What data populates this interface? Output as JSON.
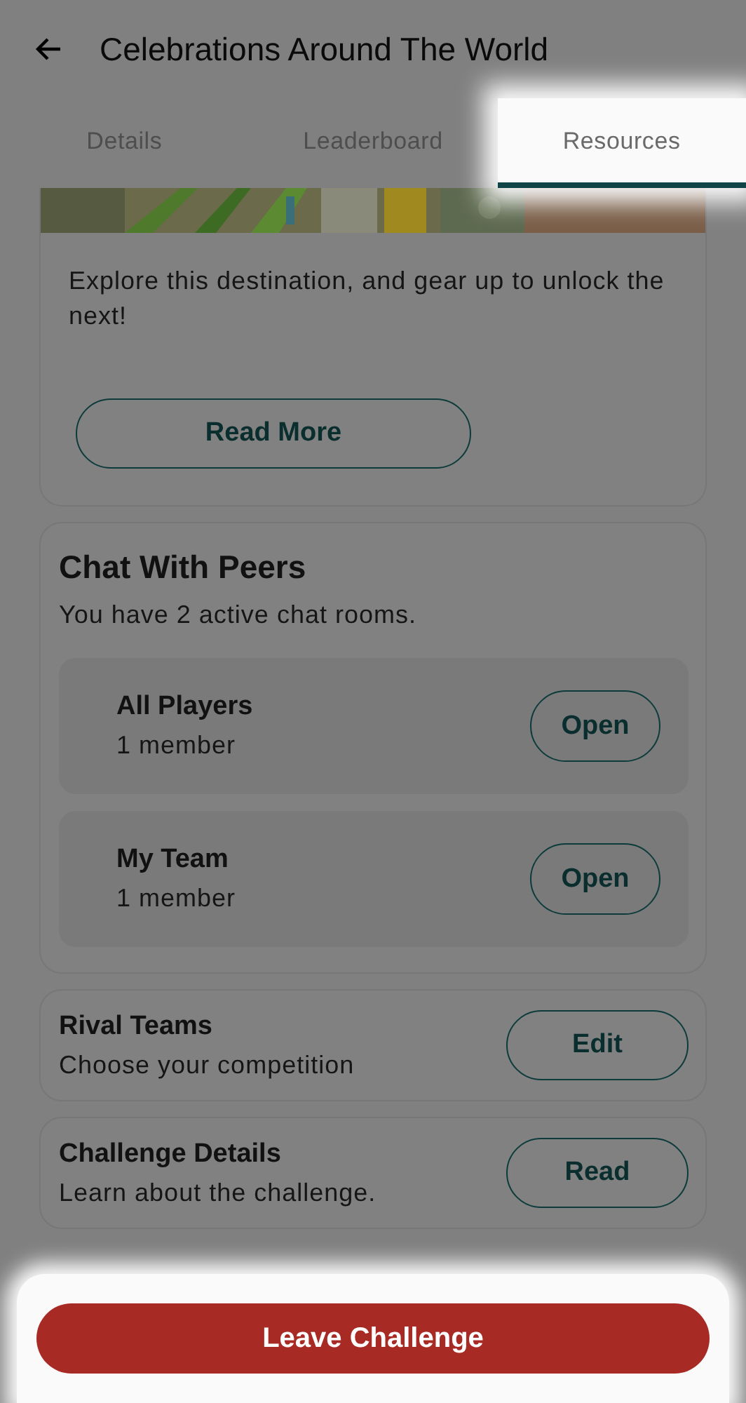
{
  "header": {
    "title": "Celebrations Around The World"
  },
  "tabs": [
    {
      "label": "Details",
      "selected": false
    },
    {
      "label": "Leaderboard",
      "selected": false
    },
    {
      "label": "Resources",
      "selected": true
    }
  ],
  "destination_card": {
    "text": "Explore this destination, and gear up to unlock the next!",
    "button": "Read More"
  },
  "chat_card": {
    "title": "Chat With Peers",
    "subtitle": "You have 2 active chat rooms.",
    "rooms": [
      {
        "name": "All Players",
        "members": "1 member",
        "button": "Open"
      },
      {
        "name": "My Team",
        "members": "1 member",
        "button": "Open"
      }
    ]
  },
  "sections": [
    {
      "title": "Rival Teams",
      "subtitle": "Choose your competition",
      "button": "Edit"
    },
    {
      "title": "Challenge Details",
      "subtitle": "Learn about the challenge.",
      "button": "Read"
    }
  ],
  "leave_button": "Leave Challenge"
}
